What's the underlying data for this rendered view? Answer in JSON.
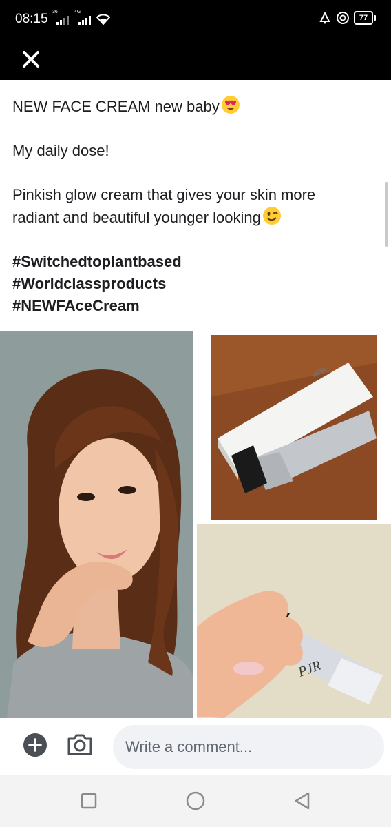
{
  "status_bar": {
    "time": "08:15",
    "signal_tag_1": "36",
    "signal_tag_2": "4G",
    "battery": "77",
    "icons": [
      "signal-icon",
      "signal-icon",
      "wifi-icon",
      "alarm-icon",
      "sync-icon",
      "battery-icon"
    ]
  },
  "header": {
    "close_icon": "close-icon"
  },
  "post": {
    "line1": "NEW FACE CREAM new baby",
    "line2": "My daily dose!",
    "line3a": "Pinkish glow cream that gives your skin more",
    "line3b": "radiant and beautiful younger looking",
    "hashtags": [
      "#Switchedtoplantbased",
      "#Worldclassproducts",
      "#NEWFAceCream"
    ],
    "emoji_1": "heart-eyes-emoji",
    "emoji_2": "wink-emoji"
  },
  "photos": {
    "portrait": "portrait-photo",
    "product_box": "product-box-photo",
    "product_hand": "product-hand-photo",
    "product_text_box": "NEW",
    "watermark": "PJR"
  },
  "comment_bar": {
    "placeholder": "Write a comment..."
  },
  "nav": {
    "recent_icon": "square-icon",
    "home_icon": "circle-icon",
    "back_icon": "triangle-back-icon"
  },
  "colors": {
    "background": "#ffffff",
    "status_bar": "#000000",
    "text": "#1c1e21",
    "input_bg": "#f0f2f5",
    "nav_bg": "#f3f3f3"
  }
}
